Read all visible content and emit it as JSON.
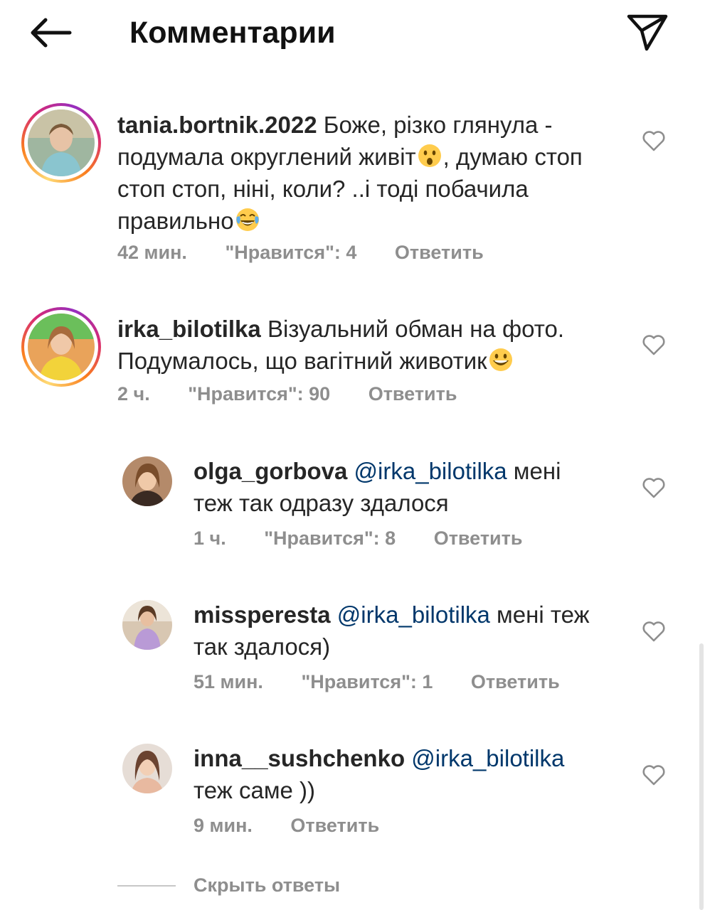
{
  "header": {
    "title": "Комментарии",
    "back_icon": "arrow-left-icon",
    "share_icon": "paper-plane-icon"
  },
  "comments": [
    {
      "username": "tania.bortnik.2022",
      "text_parts": [
        "Боже, різко глянула - подумала округлений живіт",
        ", думаю стоп стоп стоп, ніні, коли? ..і тоді побачила правильно"
      ],
      "emojis": [
        "astonished-face-icon",
        "face-with-tears-of-joy-icon"
      ],
      "time": "42 мин.",
      "likes": "\"Нравится\": 4",
      "reply_label": "Ответить",
      "has_story_ring": true
    },
    {
      "username": "irka_bilotilka",
      "text_parts": [
        "Візуальний обман на фото. Подумалось, що вагітний животик"
      ],
      "emojis": [
        "grinning-face-icon"
      ],
      "time": "2 ч.",
      "likes": "\"Нравится\": 90",
      "reply_label": "Ответить",
      "has_story_ring": true
    }
  ],
  "replies": [
    {
      "username": "olga_gorbova",
      "mention": "@irka_bilotilka",
      "text": " мені теж так одразу здалося",
      "time": "1 ч.",
      "likes": "\"Нравится\": 8",
      "reply_label": "Ответить"
    },
    {
      "username": "missperesta",
      "mention": "@irka_bilotilka",
      "text": " мені теж так здалося)",
      "time": "51 мин.",
      "likes": "\"Нравится\": 1",
      "reply_label": "Ответить"
    },
    {
      "username": "inna__sushchenko",
      "mention": "@irka_bilotilka",
      "text": " теж саме ))",
      "time": "9 мин.",
      "reply_label": "Ответить"
    }
  ],
  "hide_replies_label": "Скрыть ответы",
  "colors": {
    "text": "#262626",
    "secondary": "#8e8e8e",
    "mention": "#00376b",
    "story_ring": [
      "#feda75",
      "#fa7e1e",
      "#d62976",
      "#962fbf"
    ]
  }
}
